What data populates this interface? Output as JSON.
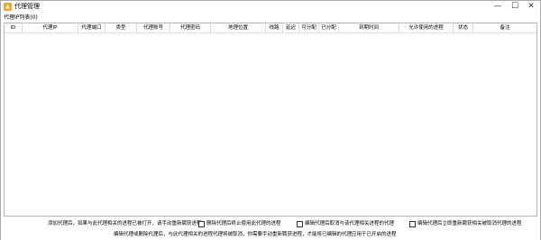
{
  "window": {
    "title": "代理管理",
    "controls": {
      "minimize": "—",
      "maximize": "☐",
      "close": "✕"
    },
    "icon": "orange-app-icon"
  },
  "list": {
    "label": "代理IP列表(0)",
    "columns": [
      "ID",
      "代理IP",
      "代理端口",
      "类型",
      "代理账号",
      "代理密码",
      "地理位置",
      "线路",
      "延迟",
      "可分配",
      "已分配",
      "到期时间",
      "允许使用的进程",
      "状态",
      "备注"
    ],
    "rows": []
  },
  "footer": {
    "tip_add": "添加代理后，如果与此代理相关的进程已被打开，请手动重新聘获进程",
    "options": [
      "删除代理后终止使用此代理的进程",
      "编辑代理后取消与该代理相关进程的代理",
      "编辑代理后立即重新聘获相关被取消代理的进程"
    ],
    "tip_edit": "编辑代理或删除代理后，与此代理相关的进程代理将被取消，你需要手动重新聘获进程，才能将已编辑的代理应用于已开启的进程"
  }
}
